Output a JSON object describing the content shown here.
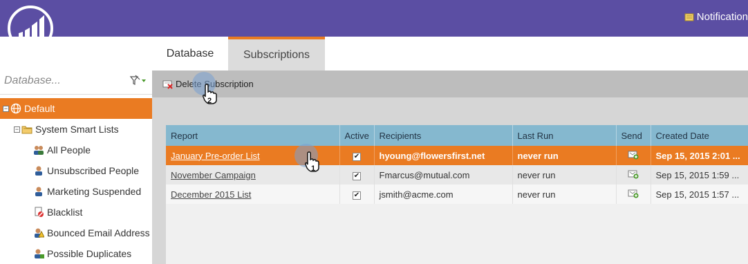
{
  "topbar": {
    "notifications_label": "Notification",
    "bg_color": "#5b4ea3"
  },
  "sidebar": {
    "search_placeholder": "Database...",
    "tree": [
      {
        "label": "Default",
        "icon": "globe-icon",
        "expander": "-",
        "selected": true
      },
      {
        "label": "System Smart Lists",
        "icon": "folder-icon",
        "expander": "-"
      },
      {
        "label": "All People",
        "icon": "people-icon"
      },
      {
        "label": "Unsubscribed People",
        "icon": "person-icon"
      },
      {
        "label": "Marketing Suspended",
        "icon": "person-icon"
      },
      {
        "label": "Blacklist",
        "icon": "blacklist-icon"
      },
      {
        "label": "Bounced Email Address",
        "icon": "warning-icon"
      },
      {
        "label": "Possible Duplicates",
        "icon": "duplicate-icon"
      }
    ]
  },
  "tabs": [
    {
      "label": "Database",
      "active": false
    },
    {
      "label": "Subscriptions",
      "active": true
    }
  ],
  "toolbar": {
    "delete_label": "Delete Subscription"
  },
  "table": {
    "headers": [
      "Report",
      "Active",
      "Recipients",
      "Last Run",
      "Send",
      "Created Date"
    ],
    "rows": [
      {
        "report": "January Pre-order List",
        "active": true,
        "recipients": "hyoung@flowersfirst.net",
        "last_run": "never run",
        "created": "Sep 15, 2015 2:01 ...",
        "selected": true
      },
      {
        "report": "November Campaign",
        "active": true,
        "recipients": "Fmarcus@mutual.com",
        "last_run": "never run",
        "created": "Sep 15, 2015 1:59 ..."
      },
      {
        "report": "December 2015 List",
        "active": true,
        "recipients": "jsmith@acme.com",
        "last_run": "never run",
        "created": "Sep 15, 2015 1:57 ..."
      }
    ]
  },
  "callouts": [
    {
      "number": "1"
    },
    {
      "number": "2"
    }
  ],
  "colors": {
    "accent": "#ea7b22",
    "header": "#85b8cf",
    "brand": "#5b4ea3"
  }
}
